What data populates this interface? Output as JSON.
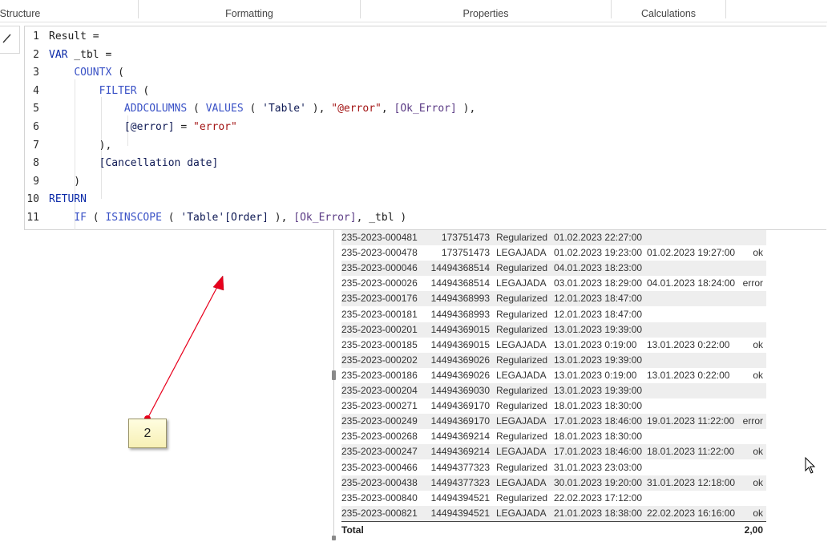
{
  "ribbon": {
    "tabs": [
      {
        "label": "Structure"
      },
      {
        "label": "Formatting"
      },
      {
        "label": "Properties"
      },
      {
        "label": "Calculations"
      }
    ]
  },
  "editor": {
    "lines": [
      {
        "n": "1",
        "tokens": [
          {
            "t": "plain",
            "v": "Result ="
          }
        ]
      },
      {
        "n": "2",
        "tokens": [
          {
            "t": "kw",
            "v": "VAR"
          },
          {
            "t": "plain",
            "v": " _tbl ="
          }
        ]
      },
      {
        "n": "3",
        "tokens": [
          {
            "t": "plain",
            "v": "    "
          },
          {
            "t": "fn",
            "v": "COUNTX"
          },
          {
            "t": "plain",
            "v": " ("
          }
        ]
      },
      {
        "n": "4",
        "tokens": [
          {
            "t": "plain",
            "v": "        "
          },
          {
            "t": "fn",
            "v": "FILTER"
          },
          {
            "t": "plain",
            "v": " ("
          }
        ]
      },
      {
        "n": "5",
        "tokens": [
          {
            "t": "plain",
            "v": "            "
          },
          {
            "t": "fn",
            "v": "ADDCOLUMNS"
          },
          {
            "t": "plain",
            "v": " ( "
          },
          {
            "t": "fn",
            "v": "VALUES"
          },
          {
            "t": "plain",
            "v": " ( "
          },
          {
            "t": "col",
            "v": "'Table'"
          },
          {
            "t": "plain",
            "v": " ), "
          },
          {
            "t": "str",
            "v": "\"@error\""
          },
          {
            "t": "plain",
            "v": ", "
          },
          {
            "t": "ref",
            "v": "[Ok_Error]"
          },
          {
            "t": "plain",
            "v": " ),"
          }
        ]
      },
      {
        "n": "6",
        "tokens": [
          {
            "t": "plain",
            "v": "            "
          },
          {
            "t": "col",
            "v": "[@error]"
          },
          {
            "t": "plain",
            "v": " = "
          },
          {
            "t": "str",
            "v": "\"error\""
          }
        ]
      },
      {
        "n": "7",
        "tokens": [
          {
            "t": "plain",
            "v": "        ),"
          }
        ]
      },
      {
        "n": "8",
        "tokens": [
          {
            "t": "plain",
            "v": "        "
          },
          {
            "t": "col",
            "v": "[Cancellation date]"
          }
        ]
      },
      {
        "n": "9",
        "tokens": [
          {
            "t": "plain",
            "v": "    )"
          }
        ]
      },
      {
        "n": "10",
        "tokens": [
          {
            "t": "kw",
            "v": "RETURN"
          }
        ]
      },
      {
        "n": "11",
        "tokens": [
          {
            "t": "plain",
            "v": "    "
          },
          {
            "t": "fn",
            "v": "IF"
          },
          {
            "t": "plain",
            "v": " ( "
          },
          {
            "t": "fn",
            "v": "ISINSCOPE"
          },
          {
            "t": "plain",
            "v": " ( "
          },
          {
            "t": "col",
            "v": "'Table'[Order]"
          },
          {
            "t": "plain",
            "v": " ), "
          },
          {
            "t": "ref",
            "v": "[Ok_Error]"
          },
          {
            "t": "plain",
            "v": ", _tbl )"
          }
        ]
      }
    ]
  },
  "table": {
    "rows": [
      {
        "order": "235-2023-000481",
        "id": "173751473",
        "status": "Regularized",
        "date": "01.02.2023 22:27:00",
        "cancel": "",
        "err": ""
      },
      {
        "order": "235-2023-000478",
        "id": "173751473",
        "status": "LEGAJADA",
        "date": "01.02.2023 19:23:00",
        "cancel": "01.02.2023 19:27:00",
        "err": "ok"
      },
      {
        "order": "235-2023-000046",
        "id": "14494368514",
        "status": "Regularized",
        "date": "04.01.2023 18:23:00",
        "cancel": "",
        "err": ""
      },
      {
        "order": "235-2023-000026",
        "id": "14494368514",
        "status": "LEGAJADA",
        "date": "03.01.2023 18:29:00",
        "cancel": "04.01.2023 18:24:00",
        "err": "error"
      },
      {
        "order": "235-2023-000176",
        "id": "14494368993",
        "status": "Regularized",
        "date": "12.01.2023 18:47:00",
        "cancel": "",
        "err": ""
      },
      {
        "order": "235-2023-000181",
        "id": "14494368993",
        "status": "Regularized",
        "date": "12.01.2023 18:47:00",
        "cancel": "",
        "err": ""
      },
      {
        "order": "235-2023-000201",
        "id": "14494369015",
        "status": "Regularized",
        "date": "13.01.2023 19:39:00",
        "cancel": "",
        "err": ""
      },
      {
        "order": "235-2023-000185",
        "id": "14494369015",
        "status": "LEGAJADA",
        "date": "13.01.2023 0:19:00",
        "cancel": "13.01.2023 0:22:00",
        "err": "ok"
      },
      {
        "order": "235-2023-000202",
        "id": "14494369026",
        "status": "Regularized",
        "date": "13.01.2023 19:39:00",
        "cancel": "",
        "err": ""
      },
      {
        "order": "235-2023-000186",
        "id": "14494369026",
        "status": "LEGAJADA",
        "date": "13.01.2023 0:19:00",
        "cancel": "13.01.2023 0:22:00",
        "err": "ok"
      },
      {
        "order": "235-2023-000204",
        "id": "14494369030",
        "status": "Regularized",
        "date": "13.01.2023 19:39:00",
        "cancel": "",
        "err": ""
      },
      {
        "order": "235-2023-000271",
        "id": "14494369170",
        "status": "Regularized",
        "date": "18.01.2023 18:30:00",
        "cancel": "",
        "err": ""
      },
      {
        "order": "235-2023-000249",
        "id": "14494369170",
        "status": "LEGAJADA",
        "date": "17.01.2023 18:46:00",
        "cancel": "19.01.2023 11:22:00",
        "err": "error"
      },
      {
        "order": "235-2023-000268",
        "id": "14494369214",
        "status": "Regularized",
        "date": "18.01.2023 18:30:00",
        "cancel": "",
        "err": ""
      },
      {
        "order": "235-2023-000247",
        "id": "14494369214",
        "status": "LEGAJADA",
        "date": "17.01.2023 18:46:00",
        "cancel": "18.01.2023 11:22:00",
        "err": "ok"
      },
      {
        "order": "235-2023-000466",
        "id": "14494377323",
        "status": "Regularized",
        "date": "31.01.2023 23:03:00",
        "cancel": "",
        "err": ""
      },
      {
        "order": "235-2023-000438",
        "id": "14494377323",
        "status": "LEGAJADA",
        "date": "30.01.2023 19:20:00",
        "cancel": "31.01.2023 12:18:00",
        "err": "ok"
      },
      {
        "order": "235-2023-000840",
        "id": "14494394521",
        "status": "Regularized",
        "date": "22.02.2023 17:12:00",
        "cancel": "",
        "err": ""
      },
      {
        "order": "235-2023-000821",
        "id": "14494394521",
        "status": "LEGAJADA",
        "date": "21.01.2023 18:38:00",
        "cancel": "22.02.2023 16:16:00",
        "err": "ok"
      }
    ],
    "total_label": "Total",
    "total_value": "2,00"
  },
  "annotation": {
    "label": "2",
    "arrow_color": "#e8001c"
  }
}
